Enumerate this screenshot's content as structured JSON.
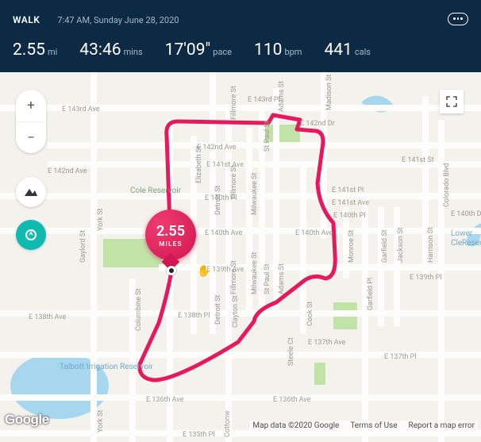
{
  "header": {
    "activity_type": "WALK",
    "timestamp": "7:47 AM, Sunday June 28, 2020"
  },
  "stats": {
    "distance": "2.55",
    "distance_unit": "mi",
    "duration": "43:46",
    "duration_unit": "mins",
    "pace": "17'09\"",
    "pace_unit": "pace",
    "heart_rate": "110",
    "heart_rate_unit": "bpm",
    "calories": "441",
    "calories_unit": "cals"
  },
  "marker": {
    "distance": "2.55",
    "unit": "MILES"
  },
  "map": {
    "zoom_in": "+",
    "zoom_out": "−",
    "google": "Google",
    "copyright": "Map data ©2020 Google",
    "terms": "Terms of Use",
    "report": "Report a map error",
    "labels": {
      "cole_reservoir": "Cole Reservoir",
      "talbott": "Talbott Irrigation Reservoir",
      "lower_cle": "Lower Cle",
      "reserv": "Reserv",
      "york_st": "York St",
      "gaylord_st": "Gaylord St",
      "columbine_st": "Columbine St",
      "clayton_st": "Clayton St",
      "elizabeth_st": "Elizabeth St",
      "detroit_st": "Detroit St",
      "fillmore_st": "Fillmore St",
      "milwaukee_st": "Milwaukee St",
      "st_paul_st": "St Paul St",
      "adams_st": "Adams St",
      "cook_st": "Cook St",
      "steele_ct": "Steele Ct",
      "madison_st": "Madison St",
      "monroe_st": "Monroe St",
      "garfield_st": "Garfield St",
      "garfield_pl": "Garfield Pl",
      "jackson_st": "Jackson St",
      "harrison_st": "Harrison St",
      "colorado_blvd": "Colorado Blvd",
      "cottonwood": "Cottonw",
      "e143rd_ave": "E 143rd Ave",
      "e143rd_pl": "E 143rd Pl",
      "e142nd_ave": "E 142nd Ave",
      "e142nd_dr": "E 142nd Dr",
      "e141st_ave": "E 141st Ave",
      "e141st_pl": "E 141st Pl",
      "e141st_st": "E 141st St",
      "e140th_ave": "E 140th Ave",
      "e140th_pl": "E 140th Pl",
      "e140th_dr": "E 140th Dr",
      "e139th_pl": "E 139th Pl",
      "e139th_ave": "E 139th Ave",
      "e138th_ave": "E 138th Ave",
      "e138th_pl": "E 138th Pl",
      "e137th_ave": "E 137th Ave",
      "e137th_pl": "E 137th Pl",
      "e136th_ave": "E 136th Ave",
      "e135th_pl": "E 135th Pl"
    }
  }
}
